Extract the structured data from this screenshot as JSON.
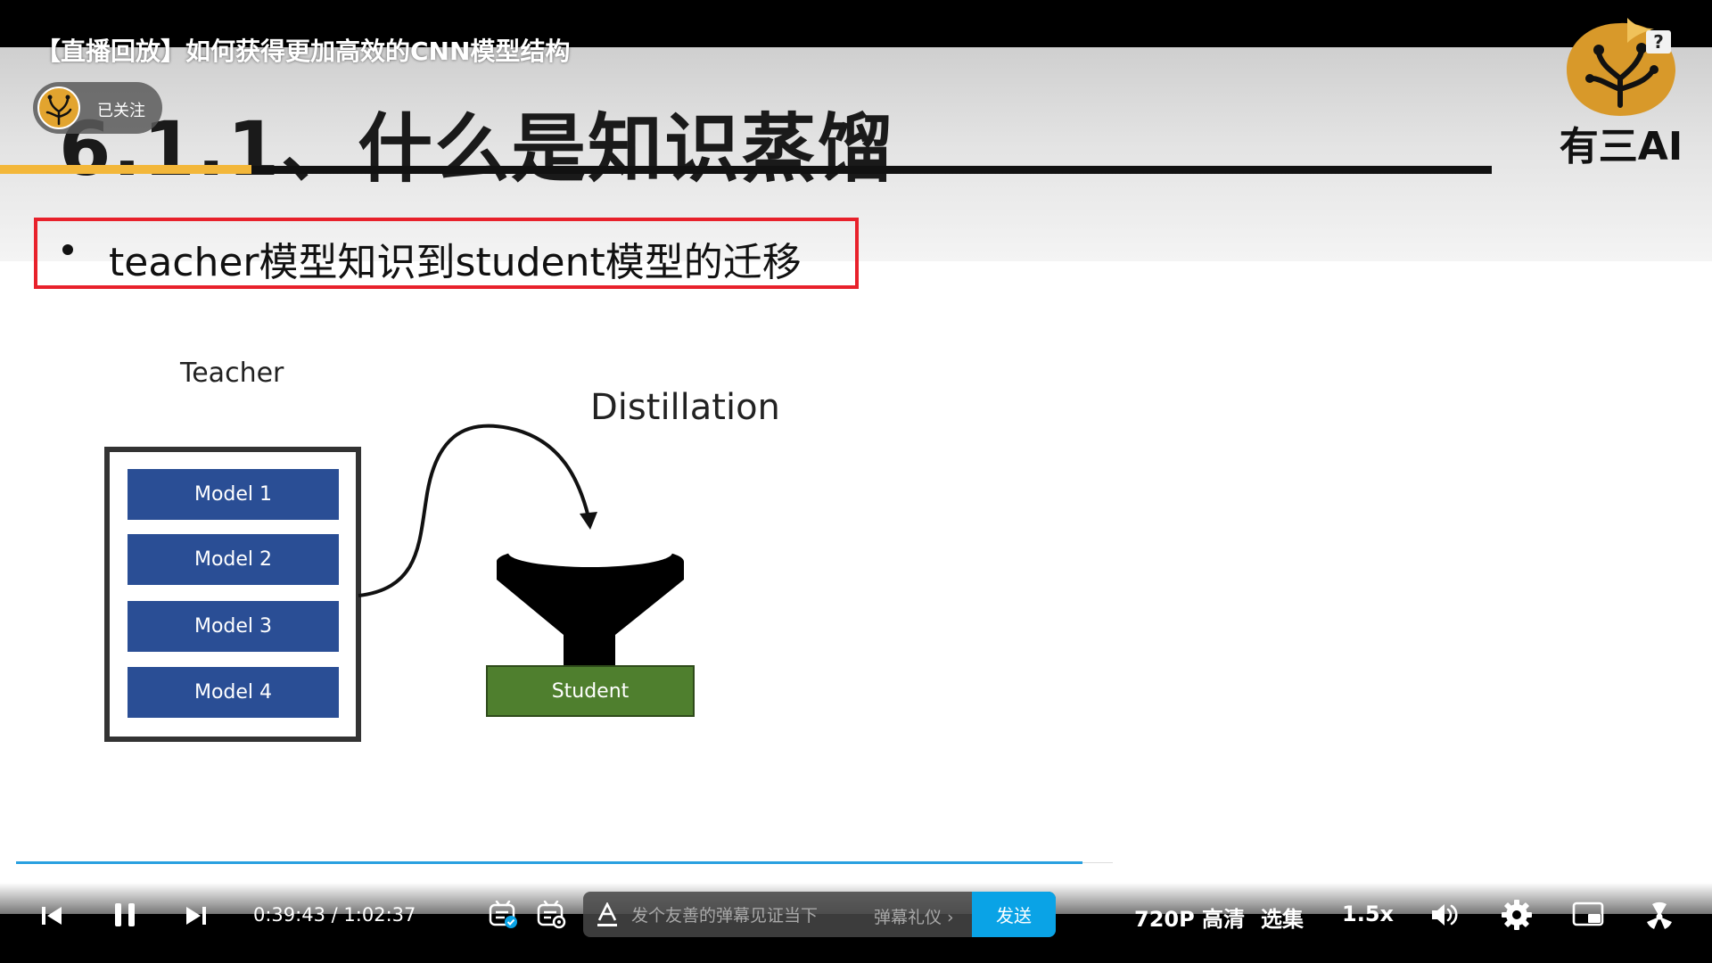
{
  "video": {
    "title": "【直播回放】如何获得更加高效的CNN模型结构",
    "help_label": "?"
  },
  "uploader": {
    "follow_status": "已关注"
  },
  "slide": {
    "title": "6.1.1、什么是知识蒸馏",
    "brand": "有三AI",
    "bullet": "teacher模型知识到student模型的迁移",
    "diagram": {
      "teacher_label": "Teacher",
      "models": [
        "Model 1",
        "Model 2",
        "Model 3",
        "Model 4"
      ],
      "distillation_label": "Distillation",
      "student_label": "Student"
    },
    "colors": {
      "accent_yellow": "#f3b73a",
      "highlight_red": "#e8212b",
      "model_blue": "#2a4e95",
      "student_green": "#4f7f2e"
    }
  },
  "player": {
    "current_time": "0:39:43",
    "time_separator": "/",
    "duration": "1:02:37",
    "progress_fraction": 0.634,
    "danmaku_placeholder": "发个友善的弹幕见证当下",
    "danmaku_etiquette": "弹幕礼仪 ›",
    "send_label": "发送",
    "quality": "720P 高清",
    "episodes": "选集",
    "speed": "1.5x",
    "icons": [
      "prev-icon",
      "pause-icon",
      "next-icon",
      "danmaku-toggle-icon",
      "danmaku-settings-icon",
      "font-style-icon",
      "volume-icon",
      "settings-icon",
      "pip-icon",
      "fullscreen-icon"
    ],
    "accent": "#0aa3e6"
  }
}
